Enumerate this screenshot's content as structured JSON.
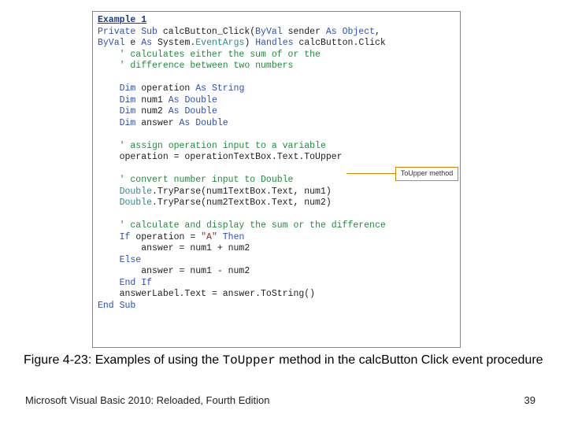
{
  "code": {
    "title": "Example 1",
    "l1a": "Private Sub",
    "l1b": " calcButton_Click(",
    "l1c": "ByVal",
    "l1d": " sender ",
    "l1e": "As Object",
    "l1f": ",",
    "l2a": "ByVal",
    "l2b": " e ",
    "l2c": "As",
    "l2d": " System.",
    "l2e": "EventArgs",
    "l2f": ") ",
    "l2g": "Handles",
    "l2h": " calcButton.Click",
    "c1": "    ' calculates either the sum of or the",
    "c2": "    ' difference between two numbers",
    "d1a": "    Dim",
    "d1b": " operation ",
    "d1c": "As String",
    "d2a": "    Dim",
    "d2b": " num1 ",
    "d2c": "As Double",
    "d3a": "    Dim",
    "d3b": " num2 ",
    "d3c": "As Double",
    "d4a": "    Dim",
    "d4b": " answer ",
    "d4c": "As Double",
    "c3": "    ' assign operation input to a variable",
    "a1": "    operation = operationTextBox.Text.ToUpper",
    "c4": "    ' convert number input to Double",
    "p1a": "    Double",
    "p1b": ".TryParse(num1TextBox.Text, num1)",
    "p2a": "    Double",
    "p2b": ".TryParse(num2TextBox.Text, num2)",
    "c5": "    ' calculate and display the sum or the difference",
    "if1a": "    If",
    "if1b": " operation = ",
    "if1c": "\"A\"",
    "if1d": " Then",
    "if2": "        answer = num1 + num2",
    "if3": "    Else",
    "if4": "        answer = num1 - num2",
    "if5": "    End If",
    "a2": "    answerLabel.Text = answer.ToString()",
    "end": "End Sub"
  },
  "callout": "ToUpper method",
  "caption": {
    "pre": "Figure 4-23: Examples of using the ",
    "mono": "ToUpper",
    "post": " method in the calcButton Click event procedure"
  },
  "footer": {
    "left": "Microsoft Visual Basic 2010: Reloaded, Fourth Edition",
    "right": "39"
  }
}
